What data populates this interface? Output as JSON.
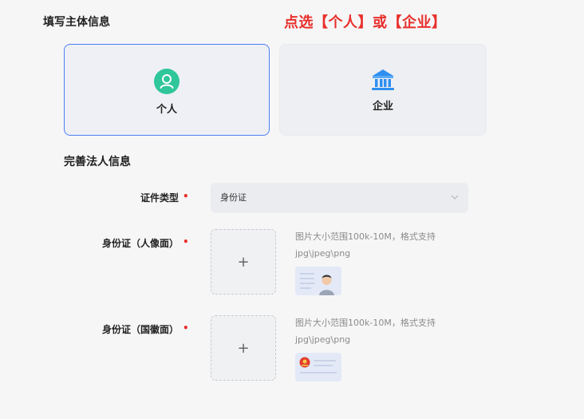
{
  "section1": {
    "title": "填写主体信息"
  },
  "hint": "点选【个人】或【企业】",
  "cards": {
    "individual": {
      "label": "个人",
      "icon": "user-icon",
      "selected": true
    },
    "enterprise": {
      "label": "企业",
      "icon": "bank-icon",
      "selected": false
    }
  },
  "section2": {
    "title": "完善法人信息"
  },
  "fields": {
    "id_type": {
      "label": "证件类型",
      "required_mark": "•",
      "value": "身份证",
      "icon": "chevron-down-icon"
    },
    "id_front": {
      "label": "身份证（人像面）",
      "required_mark": "•",
      "plus": "+",
      "note_line1": "图片大小范围100k-10M，格式支持",
      "note_line2": "jpg\\jpeg\\png"
    },
    "id_back": {
      "label": "身份证（国徽面）",
      "required_mark": "•",
      "plus": "+",
      "note_line1": "图片大小范围100k-10M，格式支持",
      "note_line2": "jpg\\jpeg\\png"
    }
  },
  "colors": {
    "accent": "#4c7cf3",
    "required": "#e8302c",
    "user_icon_bg": "#2fc69a",
    "bank_icon": "#2f8ff0"
  }
}
